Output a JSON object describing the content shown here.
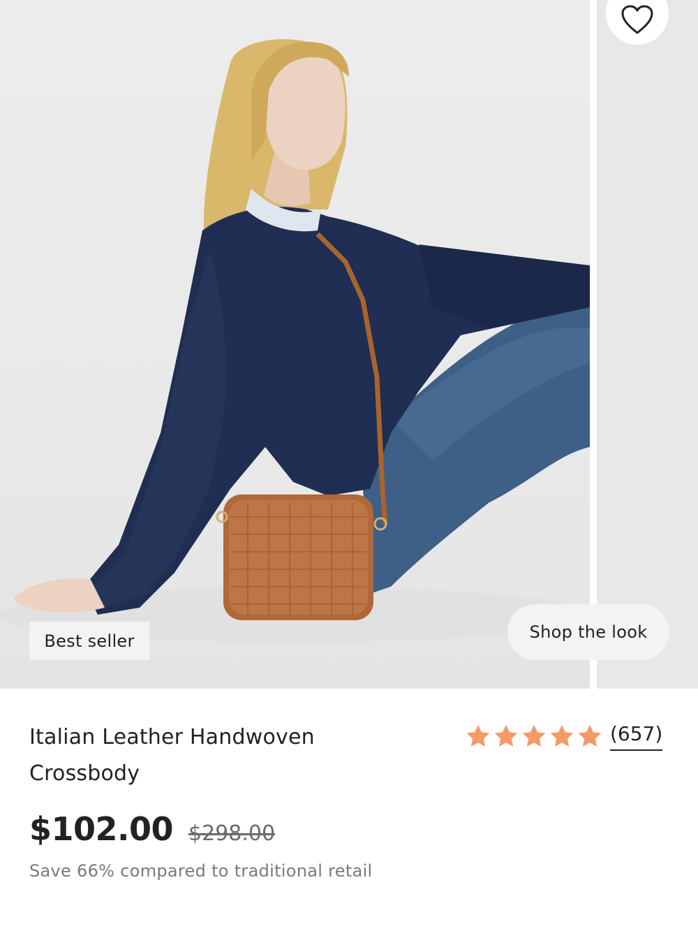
{
  "gallery": {
    "badge_label": "Best seller",
    "shop_look_label": "Shop the look",
    "favorite_icon": "heart-outline-icon"
  },
  "product": {
    "title": "Italian Leather Handwoven Crossbody",
    "rating_stars": 5,
    "review_count": "(657)",
    "price": "$102.00",
    "original_price": "$298.00",
    "savings_text": "Save 66% compared to traditional retail"
  },
  "colors": {
    "star": "#f49a66",
    "text": "#222222",
    "muted": "#7a7a7a",
    "pill_bg": "#f4f3f1"
  }
}
